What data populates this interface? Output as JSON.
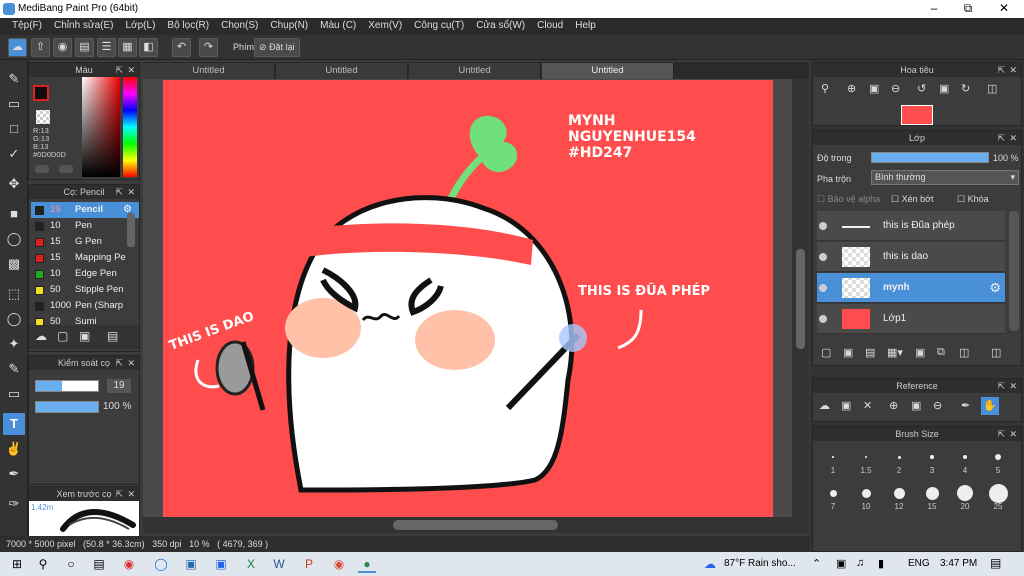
{
  "window": {
    "title": "MediBang Paint Pro (64bit)"
  },
  "menu": [
    "Tệp(F)",
    "Chỉnh sửa(E)",
    "Lớp(L)",
    "Bộ lọc(R)",
    "Chọn(S)",
    "Chụp(N)",
    "Màu (C)",
    "Xem(V)",
    "Công cụ(T)",
    "Cửa sổ(W)",
    "Cloud",
    "Help"
  ],
  "toolbar": {
    "shortcut_label": "Phím",
    "reset_label": "Đặt lại"
  },
  "color_panel": {
    "title": "Màu",
    "r": "R:13",
    "g": "G:13",
    "b": "B:13",
    "hex": "#0D0D0D"
  },
  "brush_panel": {
    "title": "Cọ: Pencil",
    "items": [
      {
        "size": "19",
        "name": "Pencil",
        "color": "#222222"
      },
      {
        "size": "10",
        "name": "Pen",
        "color": "#222222"
      },
      {
        "size": "15",
        "name": "G Pen",
        "color": "#e02020"
      },
      {
        "size": "15",
        "name": "Mapping Pe",
        "color": "#e02020"
      },
      {
        "size": "10",
        "name": "Edge Pen",
        "color": "#22aa22"
      },
      {
        "size": "50",
        "name": "Stipple Pen",
        "color": "#f0e020"
      },
      {
        "size": "1000",
        "name": "Pen (Sharp",
        "color": "#222222"
      },
      {
        "size": "50",
        "name": "Sumi",
        "color": "#f0e020"
      }
    ]
  },
  "control_panel": {
    "title": "Kiểm soát cọ",
    "size_value": "19",
    "opacity_value": "100 %"
  },
  "preview_panel": {
    "title": "Xem trước cọ",
    "size": "1.42m"
  },
  "tabs": [
    "Untitled",
    "Untitled",
    "Untitled",
    "Untitled"
  ],
  "status": "7000 * 5000 pixel   (50.8 * 36.3cm)   350 dpi   10 %   ( 4679, 369 )",
  "navigator": {
    "title": "Hoa tiêu"
  },
  "layer_panel": {
    "title": "Lớp",
    "opacity_label": "Độ trong",
    "opacity_value": "100 %",
    "blend_label": "Pha trộn",
    "blend_value": "Bình thường",
    "protect_alpha": "Bảo vệ alpha",
    "clipping": "Xén bớt",
    "lock": "Khóa",
    "layers": [
      "this is Đũa phép",
      "this is dao",
      "mynh",
      "Lớp1"
    ]
  },
  "reference_panel": {
    "title": "Reference"
  },
  "brush_size_panel": {
    "title": "Brush Size",
    "sizes": [
      "1",
      "1.5",
      "2",
      "3",
      "4",
      "5",
      "7",
      "10",
      "12",
      "15",
      "20",
      "25"
    ]
  },
  "artwork": {
    "sig1": "MYNH",
    "sig2": "NGUYENHUE154",
    "sig3": "#HD247",
    "label_dao": "THIS IS DAO",
    "label_dua": "THIS IS ĐŨA PHÉP"
  },
  "taskbar": {
    "weather": "87°F  Rain sho...",
    "lang": "ENG",
    "time": "3:47 PM"
  }
}
